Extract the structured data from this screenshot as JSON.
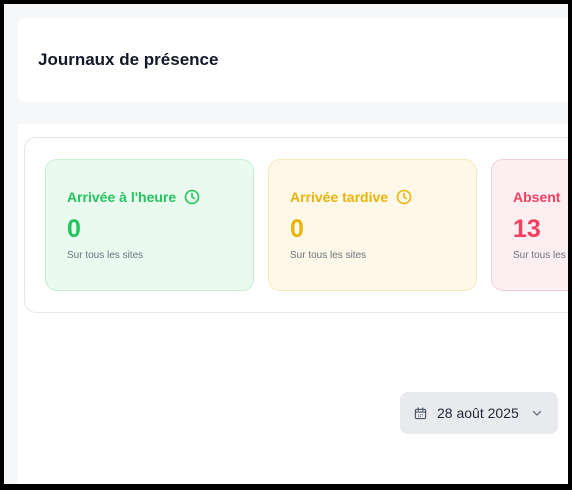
{
  "header": {
    "title": "Journaux de présence"
  },
  "stats": [
    {
      "label": "Arrivée à l'heure",
      "value": "0",
      "subtitle": "Sur tous les sites",
      "color": "#22c55e",
      "icon": "clock-icon"
    },
    {
      "label": "Arrivée tardive",
      "value": "0",
      "subtitle": "Sur tous les sites",
      "color": "#eab308",
      "icon": "clock-icon"
    },
    {
      "label": "Absent",
      "value": "13",
      "subtitle": "Sur tous les sites",
      "color": "#f43f5e"
    }
  ],
  "date_filter": {
    "value": "28 août 2025",
    "icon": "calendar-icon",
    "chevron": "chevron-down-icon"
  }
}
